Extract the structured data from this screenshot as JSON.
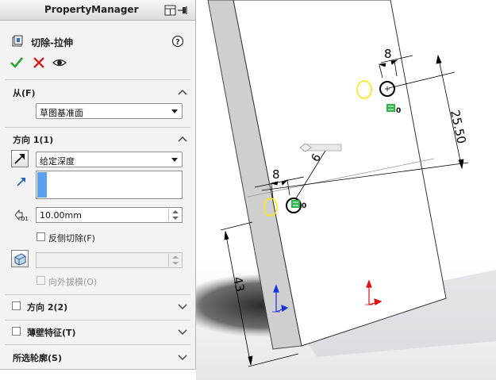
{
  "property_manager": {
    "title": "PropertyManager",
    "feature_title": "切除-拉伸",
    "actions": {
      "ok": "ok-check-icon",
      "cancel": "cancel-x-icon",
      "preview": "eye-icon"
    }
  },
  "from_section": {
    "label": "从(F)",
    "start_condition": "草图基准面"
  },
  "direction1_section": {
    "label": "方向 1(1)",
    "end_condition": "给定深度",
    "depth": "10.00mm",
    "flip_side_label": "反侧切除(F)",
    "draft_outward_label": "向外拔模(O)",
    "depth_icon_text": "D1"
  },
  "direction2_section": {
    "label": "方向 2(2)"
  },
  "thin_feature_section": {
    "label": "薄壁特征(T)"
  },
  "selected_contours_section": {
    "label": "所选轮廓(S)"
  },
  "viewport": {
    "dim_circle_top": "8",
    "dim_circle_bottom": "8",
    "dim_vertical": "25.50",
    "dim_height": "43",
    "dim_diameter": "6",
    "relation_label_top": "0",
    "relation_label_bottom": "0"
  },
  "colors": {
    "sketch_black": "#000000",
    "constraint_green": "#2fb34a",
    "highlight_yellow": "#ffe600",
    "axis_red": "#e01010",
    "axis_blue": "#1830e0",
    "selection_blue": "#5aa0f0"
  }
}
